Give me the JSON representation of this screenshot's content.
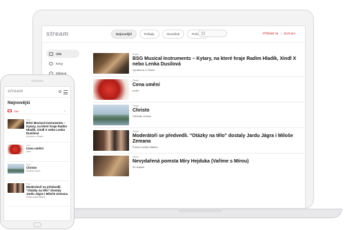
{
  "laptop": {
    "logo": "stream",
    "tabs": [
      "Nejnovější",
      "Pořady",
      "Oceněné",
      "Pohádky"
    ],
    "account": {
      "login": "Přihlásit se",
      "separator": "|",
      "register": "Seznam"
    },
    "sidebar": [
      {
        "label": "Vše",
        "icon": "grid-icon",
        "active": true
      },
      {
        "label": "Kecy",
        "icon": "hand-icon",
        "active": false
      },
      {
        "label": "Zábava",
        "icon": "smile-icon",
        "active": false
      }
    ],
    "videos": [
      {
        "meta": "Dnes",
        "title": "BSG Musical Instruments – Kytary, na které hraje Radim Hladík, Xindl X nebo Lenka Dusilová",
        "subtitle": "Vyrobeno v Česku"
      },
      {
        "meta": "Dnes",
        "title": "Cena umění",
        "subtitle": "uměl"
      },
      {
        "meta": "Dnes",
        "title": "Christo",
        "subtitle": "Gebrian versus"
      },
      {
        "meta": "Dnes",
        "title": "Moderátoři se předvedli. \"Otázky na tělo\" dostaly Jardu Jágra i Miloše Zemana",
        "subtitle": "Pořad Luďka Staňka"
      },
      {
        "meta": "Dnes",
        "title": "Nevydařená pomsta Míry Hejduka (Vaříme s Mírou)",
        "subtitle": "33 zlápek"
      }
    ]
  },
  "phone": {
    "logo": "stream",
    "page_title": "Nejnovější",
    "filter": "Vše",
    "videos": [
      {
        "meta": "Dnes",
        "title": "BSG Musical Instruments – Kytary, na které hraje Radim Hladík, Xindl X nebo Lenka Dusilová",
        "subtitle": "Vyrobeno v Česku"
      },
      {
        "meta": "Dnes",
        "title": "Cena umění",
        "subtitle": "uměl"
      },
      {
        "meta": "Dnes",
        "title": "Christo",
        "subtitle": "Gebrian versus"
      },
      {
        "meta": "Dnes",
        "title": "Moderátoři se předvedli. \"Otázky na tělo\" dostaly Jardu Jágra i Miloše Zemana",
        "subtitle": "Pořad Luďka Staňka"
      }
    ]
  },
  "colors": {
    "accent": "#cc2222",
    "chrome": "#f3f3f4"
  }
}
